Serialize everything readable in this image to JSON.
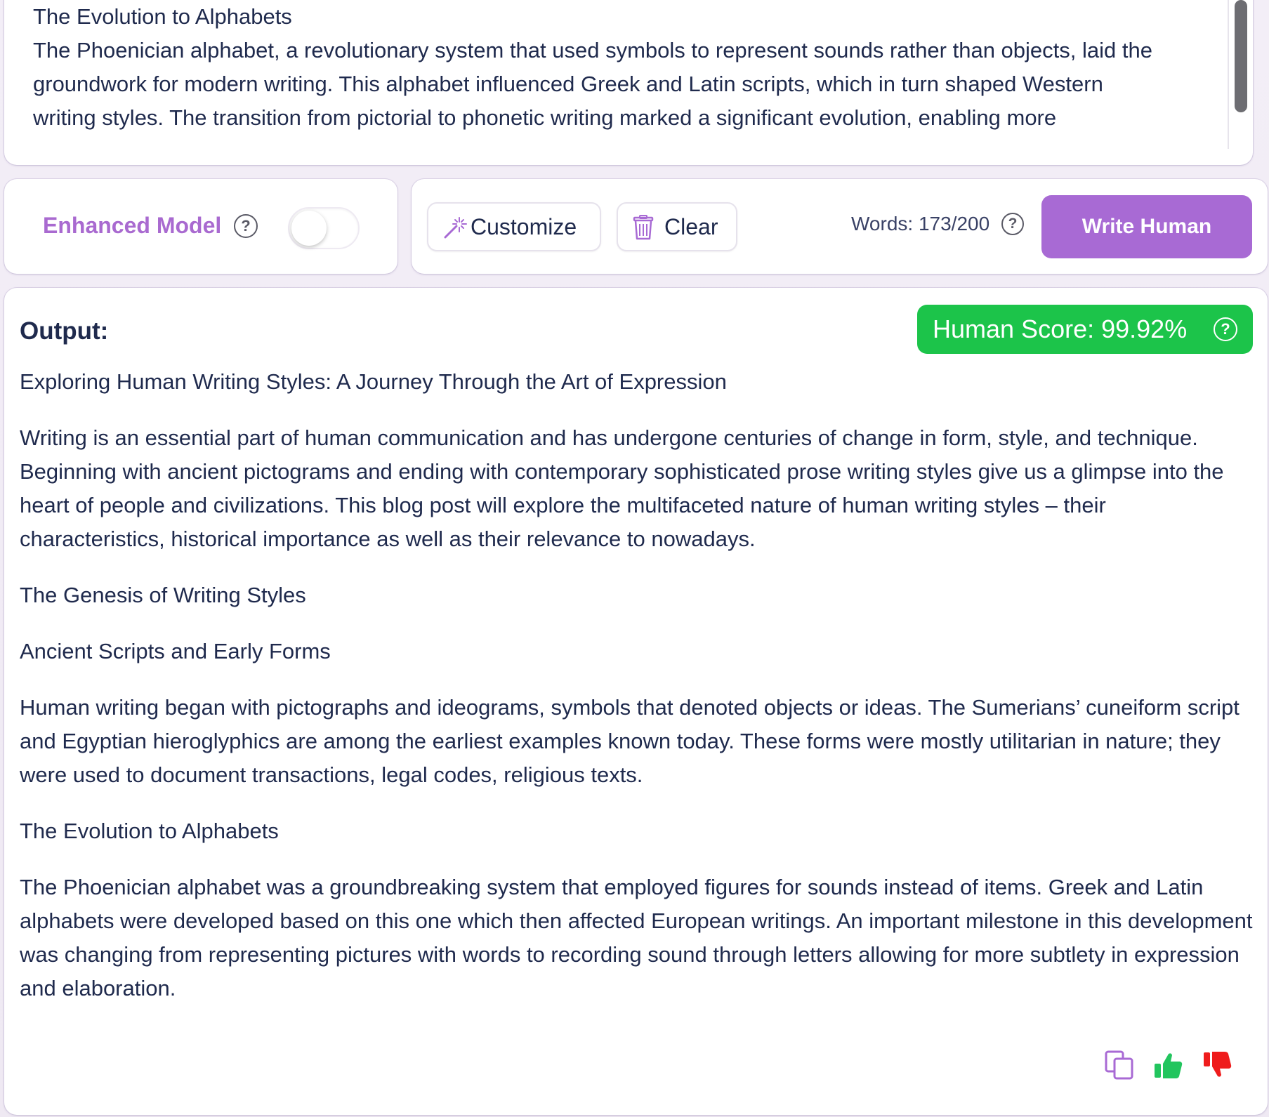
{
  "input": {
    "lines": [
      "The Evolution to Alphabets",
      "The Phoenician alphabet, a revolutionary system that used symbols to represent sounds rather than objects, laid the",
      "groundwork for modern writing. This alphabet influenced Greek and Latin scripts, which in turn shaped Western",
      "writing styles. The transition from pictorial to phonetic writing marked a significant evolution, enabling more"
    ]
  },
  "controls": {
    "enhanced_model_label": "Enhanced Model",
    "enhanced_model_enabled": false,
    "customize_label": "Customize",
    "clear_label": "Clear",
    "words_label": "Words: 173/200",
    "write_button_label": "Write Human"
  },
  "output": {
    "label": "Output:",
    "human_score": "Human Score: 99.92%",
    "paragraphs": [
      "Exploring Human Writing Styles: A Journey Through the Art of Expression",
      "Writing is an essential part of human communication and has undergone centuries of change in form, style, and technique. Beginning with ancient pictograms and ending with contemporary sophisticated prose writing styles give us a glimpse into the heart of people and civilizations. This blog post will explore the multifaceted nature of human writing styles – their characteristics, historical importance as well as their relevance to nowadays.",
      "The Genesis of Writing Styles",
      "Ancient Scripts and Early Forms",
      "Human writing began with pictographs and ideograms, symbols that denoted objects or ideas. The Sumerians’ cuneiform script and Egyptian hieroglyphics are among the earliest examples known today. These forms were mostly utilitarian in nature; they were used to document transactions, legal codes, religious texts.",
      "The Evolution to Alphabets",
      "The Phoenician alphabet was a groundbreaking system that employed figures for sounds instead of items. Greek and Latin alphabets were developed based on this one which then affected European writings. An important milestone in this development was changing from representing pictures with words to recording sound through letters allowing for more subtlety in expression and elaboration."
    ]
  },
  "icons": {
    "help": "question-circle-icon",
    "customize": "magic-wand-icon",
    "clear": "trash-icon",
    "copy": "copy-icon",
    "like": "thumbs-up-icon",
    "dislike": "thumbs-down-icon"
  },
  "colors": {
    "accent": "#a86ad4",
    "accent_text": "#a96ad0",
    "score_green": "#1cc44a",
    "like_green": "#22c55e",
    "dislike_red": "#ef1c1c",
    "text": "#1f2a4d"
  }
}
